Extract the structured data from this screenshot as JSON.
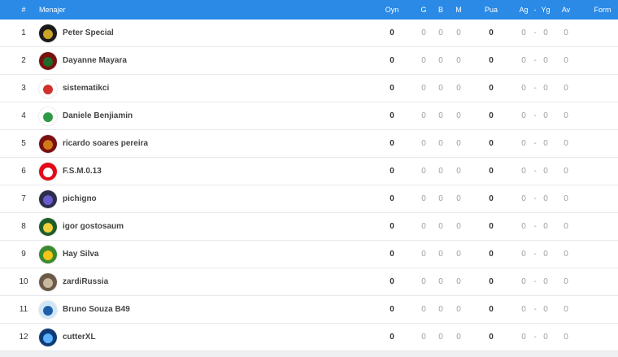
{
  "header": {
    "num": "#",
    "manager": "Menajer",
    "oyn": "Oyn",
    "g": "G",
    "b": "B",
    "m": "M",
    "pua": "Pua",
    "ag": "Ag",
    "dash": "-",
    "yg": "Yg",
    "av": "Av",
    "form": "Form"
  },
  "rows": [
    {
      "rank": "1",
      "name": "Peter Special",
      "oyn": "0",
      "g": "0",
      "b": "0",
      "m": "0",
      "pua": "0",
      "ag": "0",
      "dash": "-",
      "yg": "0",
      "av": "0",
      "avatar_color": "#1a1a1a",
      "avatar_accent": "#c9a227"
    },
    {
      "rank": "2",
      "name": "Dayanne Mayara",
      "oyn": "0",
      "g": "0",
      "b": "0",
      "m": "0",
      "pua": "0",
      "ag": "0",
      "dash": "-",
      "yg": "0",
      "av": "0",
      "avatar_color": "#7a1010",
      "avatar_accent": "#1f6b2a"
    },
    {
      "rank": "3",
      "name": "sistematikci",
      "oyn": "0",
      "g": "0",
      "b": "0",
      "m": "0",
      "pua": "0",
      "ag": "0",
      "dash": "-",
      "yg": "0",
      "av": "0",
      "avatar_color": "#ffffff",
      "avatar_accent": "#d0312d"
    },
    {
      "rank": "4",
      "name": "Daniele Benjiamin",
      "oyn": "0",
      "g": "0",
      "b": "0",
      "m": "0",
      "pua": "0",
      "ag": "0",
      "dash": "-",
      "yg": "0",
      "av": "0",
      "avatar_color": "#ffffff",
      "avatar_accent": "#2e9b44"
    },
    {
      "rank": "5",
      "name": "ricardo soares pereira",
      "oyn": "0",
      "g": "0",
      "b": "0",
      "m": "0",
      "pua": "0",
      "ag": "0",
      "dash": "-",
      "yg": "0",
      "av": "0",
      "avatar_color": "#7a1010",
      "avatar_accent": "#d07a16"
    },
    {
      "rank": "6",
      "name": "F.S.M.0.13",
      "oyn": "0",
      "g": "0",
      "b": "0",
      "m": "0",
      "pua": "0",
      "ag": "0",
      "dash": "-",
      "yg": "0",
      "av": "0",
      "avatar_color": "#e30a17",
      "avatar_accent": "#ffffff"
    },
    {
      "rank": "7",
      "name": "pichigno",
      "oyn": "0",
      "g": "0",
      "b": "0",
      "m": "0",
      "pua": "0",
      "ag": "0",
      "dash": "-",
      "yg": "0",
      "av": "0",
      "avatar_color": "#2b2f4a",
      "avatar_accent": "#6a5acd"
    },
    {
      "rank": "8",
      "name": "igor gostosaum",
      "oyn": "0",
      "g": "0",
      "b": "0",
      "m": "0",
      "pua": "0",
      "ag": "0",
      "dash": "-",
      "yg": "0",
      "av": "0",
      "avatar_color": "#1f5d2b",
      "avatar_accent": "#f2d03b"
    },
    {
      "rank": "9",
      "name": "Hay Silva",
      "oyn": "0",
      "g": "0",
      "b": "0",
      "m": "0",
      "pua": "0",
      "ag": "0",
      "dash": "-",
      "yg": "0",
      "av": "0",
      "avatar_color": "#3a8a2e",
      "avatar_accent": "#f5c518"
    },
    {
      "rank": "10",
      "name": "zardiRussia",
      "oyn": "0",
      "g": "0",
      "b": "0",
      "m": "0",
      "pua": "0",
      "ag": "0",
      "dash": "-",
      "yg": "0",
      "av": "0",
      "avatar_color": "#6b5a48",
      "avatar_accent": "#c9b8a0"
    },
    {
      "rank": "11",
      "name": "Bruno Souza B49",
      "oyn": "0",
      "g": "0",
      "b": "0",
      "m": "0",
      "pua": "0",
      "ag": "0",
      "dash": "-",
      "yg": "0",
      "av": "0",
      "avatar_color": "#cfe6f7",
      "avatar_accent": "#1e5fa8"
    },
    {
      "rank": "12",
      "name": "cutterXL",
      "oyn": "0",
      "g": "0",
      "b": "0",
      "m": "0",
      "pua": "0",
      "ag": "0",
      "dash": "-",
      "yg": "0",
      "av": "0",
      "avatar_color": "#0d3b78",
      "avatar_accent": "#5ab0ff"
    }
  ]
}
